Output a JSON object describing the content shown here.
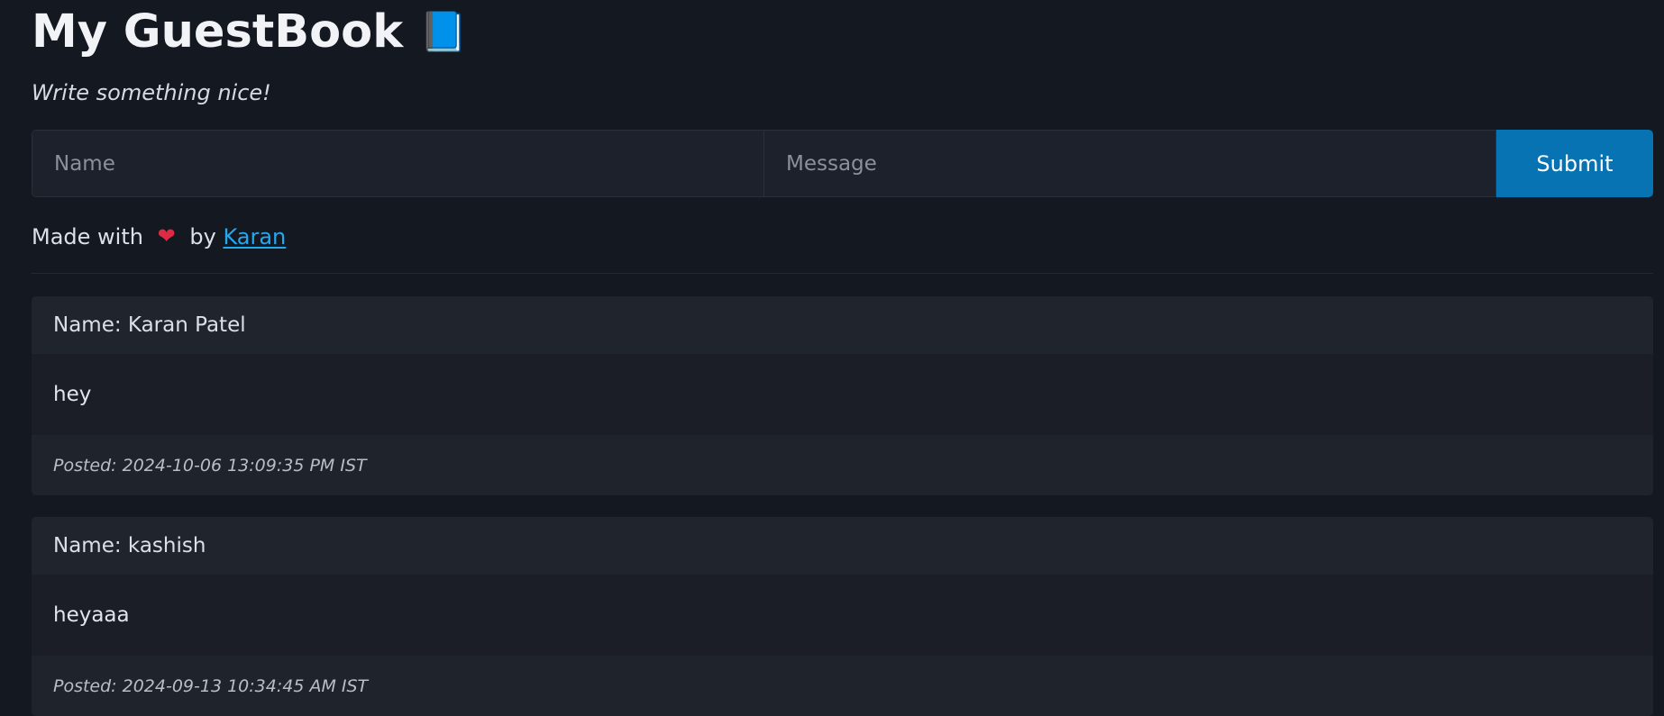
{
  "header": {
    "title": "My GuestBook",
    "title_emoji": "📘",
    "subtitle": "Write something nice!"
  },
  "form": {
    "name_placeholder": "Name",
    "message_placeholder": "Message",
    "submit_label": "Submit"
  },
  "footer": {
    "made_with": "Made with",
    "heart": "❤",
    "by": "by",
    "author": "Karan"
  },
  "entries": [
    {
      "name": "Name: Karan Patel",
      "message": "hey",
      "posted": "Posted: 2024-10-06 13:09:35 PM IST"
    },
    {
      "name": "Name: kashish",
      "message": "heyaaa",
      "posted": "Posted: 2024-09-13 10:34:45 AM IST"
    }
  ],
  "colors": {
    "background": "#141821",
    "accent": "#0773b3",
    "link": "#24a8ef",
    "heart": "#e02a44"
  }
}
